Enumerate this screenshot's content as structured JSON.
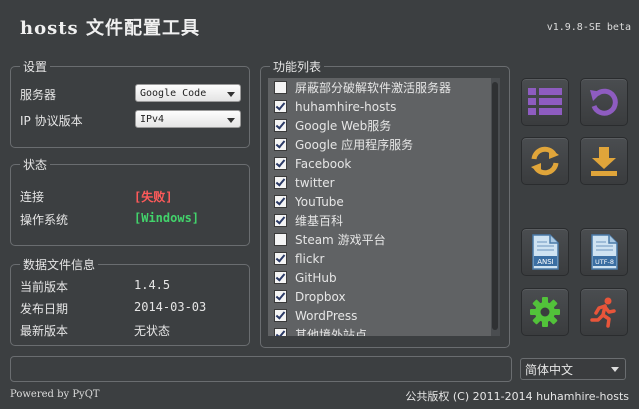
{
  "app": {
    "title": "hosts 文件配置工具",
    "version": "v1.9.8-SE beta"
  },
  "settings": {
    "legend": "设置",
    "server_label": "服务器",
    "server_value": "Google Code",
    "ip_label": "IP 协议版本",
    "ip_value": "IPv4"
  },
  "status": {
    "legend": "状态",
    "connection_label": "连接",
    "connection_value": "[失败]",
    "os_label": "操作系统",
    "os_value": "[Windows]",
    "fail_color": "#ff5a5a",
    "ok_color": "#42d36b"
  },
  "datafile": {
    "legend": "数据文件信息",
    "current_label": "当前版本",
    "current_value": "1.4.5",
    "release_label": "发布日期",
    "release_value": "2014-03-03",
    "latest_label": "最新版本",
    "latest_value": "无状态"
  },
  "functions": {
    "legend": "功能列表",
    "items": [
      {
        "label": "屏蔽部分破解软件激活服务器",
        "checked": false
      },
      {
        "label": "huhamhire-hosts",
        "checked": true
      },
      {
        "label": "Google Web服务",
        "checked": true
      },
      {
        "label": "Google 应用程序服务",
        "checked": true
      },
      {
        "label": "Facebook",
        "checked": true
      },
      {
        "label": "twitter",
        "checked": true
      },
      {
        "label": "YouTube",
        "checked": true
      },
      {
        "label": "维基百科",
        "checked": true
      },
      {
        "label": "Steam 游戏平台",
        "checked": false
      },
      {
        "label": "flickr",
        "checked": true
      },
      {
        "label": "GitHub",
        "checked": true
      },
      {
        "label": "Dropbox",
        "checked": true
      },
      {
        "label": "WordPress",
        "checked": true
      },
      {
        "label": "其他境外站点",
        "checked": true
      }
    ]
  },
  "toolbar": {
    "ansi_label": "ANSI",
    "utf8_label": "UTF-8",
    "accent_purple": "#8e5cc0",
    "accent_orange": "#e0a53a",
    "accent_green": "#52c23a",
    "accent_red": "#e8553a"
  },
  "bottom": {
    "language_value": "简体中文",
    "powered_by": "Powered by PyQT",
    "copyright": "公共版权 (C) 2011-2014 huhamhire-hosts"
  }
}
